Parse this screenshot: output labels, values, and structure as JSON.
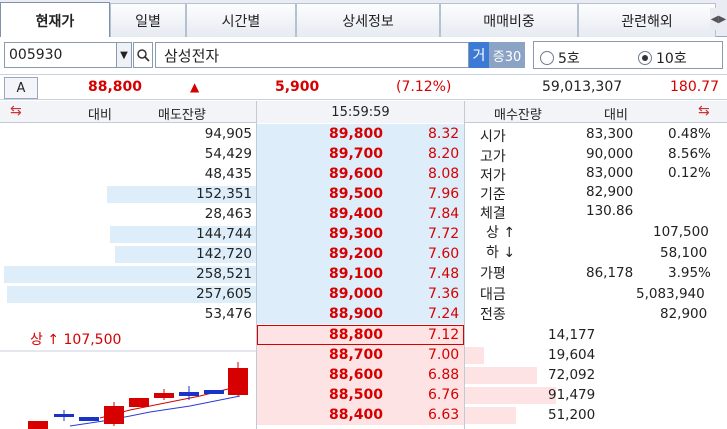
{
  "tabs": [
    "현재가",
    "일별",
    "시간별",
    "상세정보",
    "매매비중",
    "관련해외"
  ],
  "search": {
    "code": "005930",
    "name": "삼성전자",
    "geo_label": "거",
    "jeung_label": "증30",
    "radio_5": "5호",
    "radio_10": "10호"
  },
  "price_row": {
    "a_label": "A",
    "price": "88,800",
    "arrow": "▲",
    "change": "5,900",
    "rate": "(7.12%)",
    "volume": "59,013,307",
    "vol_ratio": "180.77"
  },
  "header": {
    "daebi_left": "대비",
    "sell_remain": "매도잔량",
    "time": "15:59:59",
    "buy_remain": "매수잔량",
    "daebi_right": "대비"
  },
  "asks": [
    {
      "qty": "94,905",
      "price": "89,800",
      "rate": "8.32",
      "bar": 0.0
    },
    {
      "qty": "54,429",
      "price": "89,700",
      "rate": "8.20",
      "bar": 0.0
    },
    {
      "qty": "48,435",
      "price": "89,600",
      "rate": "8.08",
      "bar": 0.0
    },
    {
      "qty": "152,351",
      "price": "89,500",
      "rate": "7.96",
      "bar": 0.59
    },
    {
      "qty": "28,463",
      "price": "89,400",
      "rate": "7.84",
      "bar": 0.0
    },
    {
      "qty": "144,744",
      "price": "89,300",
      "rate": "7.72",
      "bar": 0.58
    },
    {
      "qty": "142,720",
      "price": "89,200",
      "rate": "7.60",
      "bar": 0.56
    },
    {
      "qty": "258,521",
      "price": "89,100",
      "rate": "7.48",
      "bar": 1.0
    },
    {
      "qty": "257,605",
      "price": "89,000",
      "rate": "7.36",
      "bar": 0.99
    },
    {
      "qty": "53,476",
      "price": "88,900",
      "rate": "7.24",
      "bar": 0.0
    }
  ],
  "bids": [
    {
      "qty": "14,177",
      "price": "88,800",
      "rate": "7.12",
      "bar": 0.0
    },
    {
      "qty": "19,604",
      "price": "88,700",
      "rate": "7.00",
      "bar": 0.1
    },
    {
      "qty": "72,092",
      "price": "88,600",
      "rate": "6.88",
      "bar": 0.38
    },
    {
      "qty": "91,479",
      "price": "88,500",
      "rate": "6.76",
      "bar": 0.48
    },
    {
      "qty": "51,200",
      "price": "88,400",
      "rate": "6.63",
      "bar": 0.27
    }
  ],
  "info": {
    "open_label": "시가",
    "open": "83,300",
    "open_rate": "0.48%",
    "high_label": "고가",
    "high": "90,000",
    "high_rate": "8.56%",
    "low_label": "저가",
    "low": "83,000",
    "low_rate": "0.12%",
    "base_label": "기준",
    "base": "82,900",
    "strength_label": "체결",
    "strength": "130.86",
    "upper_label": "상 ↑",
    "upper": "107,500",
    "lower_label": "하 ↓",
    "lower": "58,100",
    "avg_label": "가평",
    "avg": "86,178",
    "avg_rate": "3.95%",
    "amount_label": "대금",
    "amount": "5,083,940",
    "prev_label": "전종",
    "prev": "82,900"
  },
  "chart": {
    "upper_label": "상 ↑ 107,500"
  }
}
